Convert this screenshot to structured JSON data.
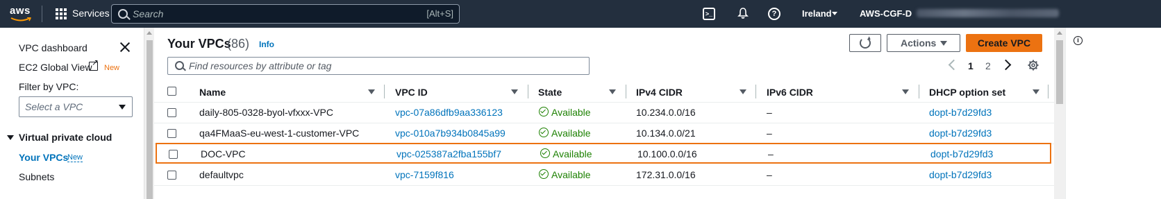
{
  "topnav": {
    "logo": "aws",
    "services_label": "Services",
    "search_placeholder": "Search",
    "search_shortcut": "[Alt+S]",
    "region": "Ireland",
    "account": "AWS-CGF-D"
  },
  "sidebar": {
    "dashboard": "VPC dashboard",
    "ec2_global_view": "EC2 Global View",
    "ec2_new_badge": "New",
    "filter_label": "Filter by VPC:",
    "select_placeholder": "Select a VPC",
    "section_title": "Virtual private cloud",
    "your_vpcs": "Your VPCs",
    "your_vpcs_badge": "New",
    "subnets": "Subnets"
  },
  "main": {
    "title": "Your VPCs",
    "count": "(86)",
    "info_link": "Info",
    "actions_label": "Actions",
    "create_label": "Create VPC",
    "filter_placeholder": "Find resources by attribute or tag",
    "pages": [
      "1",
      "2"
    ],
    "current_page": "1"
  },
  "table": {
    "columns": [
      "Name",
      "VPC ID",
      "State",
      "IPv4 CIDR",
      "IPv6 CIDR",
      "DHCP option set"
    ],
    "rows": [
      {
        "name": "daily-805-0328-byol-vfxxx-VPC",
        "vpc_id": "vpc-07a86dfb9aa336123",
        "state": "Available",
        "ipv4": "10.234.0.0/16",
        "ipv6": "–",
        "dhcp": "dopt-b7d29fd3"
      },
      {
        "name": "qa4FMaaS-eu-west-1-customer-VPC",
        "vpc_id": "vpc-010a7b934b0845a99",
        "state": "Available",
        "ipv4": "10.134.0.0/21",
        "ipv6": "–",
        "dhcp": "dopt-b7d29fd3"
      },
      {
        "name": "DOC-VPC",
        "vpc_id": "vpc-025387a2fba155bf7",
        "state": "Available",
        "ipv4": "10.100.0.0/16",
        "ipv6": "–",
        "dhcp": "dopt-b7d29fd3",
        "highlighted": true
      },
      {
        "name": "defaultvpc",
        "vpc_id": "vpc-7159f816",
        "state": "Available",
        "ipv4": "172.31.0.0/16",
        "ipv6": "–",
        "dhcp": "dopt-b7d29fd3"
      }
    ]
  },
  "colors": {
    "nav_bg": "#232f3e",
    "link": "#0073bb",
    "primary_button": "#ec7211",
    "available": "#1d8102",
    "highlight_border": "#ec7211"
  }
}
